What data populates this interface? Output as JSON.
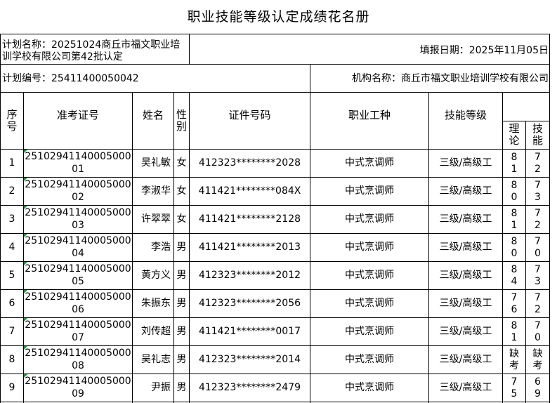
{
  "title": "职业技能等级认定成绩花名册",
  "plan_name_label": "计划名称：",
  "plan_name_value": "20251024商丘市福文职业培训学校有限公司第42批认定",
  "fill_date_label": "填报日期：",
  "fill_date_value": "2025年11月05日",
  "plan_no_label": "计划编号：",
  "plan_no_value": "25411400050042",
  "org_label": "机构名称：",
  "org_value": "商丘市福文职业培训学校有限公司",
  "headers": {
    "seq": "序号",
    "ticket": "准考证号",
    "name": "姓名",
    "gender": "性别",
    "id": "证件号码",
    "occupation": "职业工种",
    "level": "技能等级",
    "theory": "理论",
    "skill": "技能"
  },
  "rows": [
    {
      "seq": "1",
      "ticket": "2510294114000500001",
      "name": "吴礼敏",
      "gender": "女",
      "id": "412323********2028",
      "occupation": "中式烹调师",
      "level": "三级/高级工",
      "theory": "81",
      "skill": "72"
    },
    {
      "seq": "2",
      "ticket": "2510294114000500002",
      "name": "李淑华",
      "gender": "女",
      "id": "411421********084X",
      "occupation": "中式烹调师",
      "level": "三级/高级工",
      "theory": "80",
      "skill": "73"
    },
    {
      "seq": "3",
      "ticket": "2510294114000500003",
      "name": "许翠翠",
      "gender": "女",
      "id": "411421********2128",
      "occupation": "中式烹调师",
      "level": "三级/高级工",
      "theory": "81",
      "skill": "72"
    },
    {
      "seq": "4",
      "ticket": "2510294114000500004",
      "name": "李浩",
      "gender": "男",
      "id": "411421********2013",
      "occupation": "中式烹调师",
      "level": "三级/高级工",
      "theory": "80",
      "skill": "70"
    },
    {
      "seq": "5",
      "ticket": "2510294114000500005",
      "name": "黄方义",
      "gender": "男",
      "id": "412323********2012",
      "occupation": "中式烹调师",
      "level": "三级/高级工",
      "theory": "84",
      "skill": "73"
    },
    {
      "seq": "6",
      "ticket": "2510294114000500006",
      "name": "朱振东",
      "gender": "男",
      "id": "412323********2056",
      "occupation": "中式烹调师",
      "level": "三级/高级工",
      "theory": "76",
      "skill": "72"
    },
    {
      "seq": "7",
      "ticket": "2510294114000500007",
      "name": "刘传超",
      "gender": "男",
      "id": "411421********0017",
      "occupation": "中式烹调师",
      "level": "三级/高级工",
      "theory": "81",
      "skill": "70"
    },
    {
      "seq": "8",
      "ticket": "2510294114000500008",
      "name": "吴礼志",
      "gender": "男",
      "id": "412323********2014",
      "occupation": "中式烹调师",
      "level": "三级/高级工",
      "theory": "缺考",
      "skill": "缺考"
    },
    {
      "seq": "9",
      "ticket": "2510294114000500009",
      "name": "尹振",
      "gender": "男",
      "id": "412323********2479",
      "occupation": "中式烹调师",
      "level": "三级/高级工",
      "theory": "75",
      "skill": "69"
    }
  ]
}
